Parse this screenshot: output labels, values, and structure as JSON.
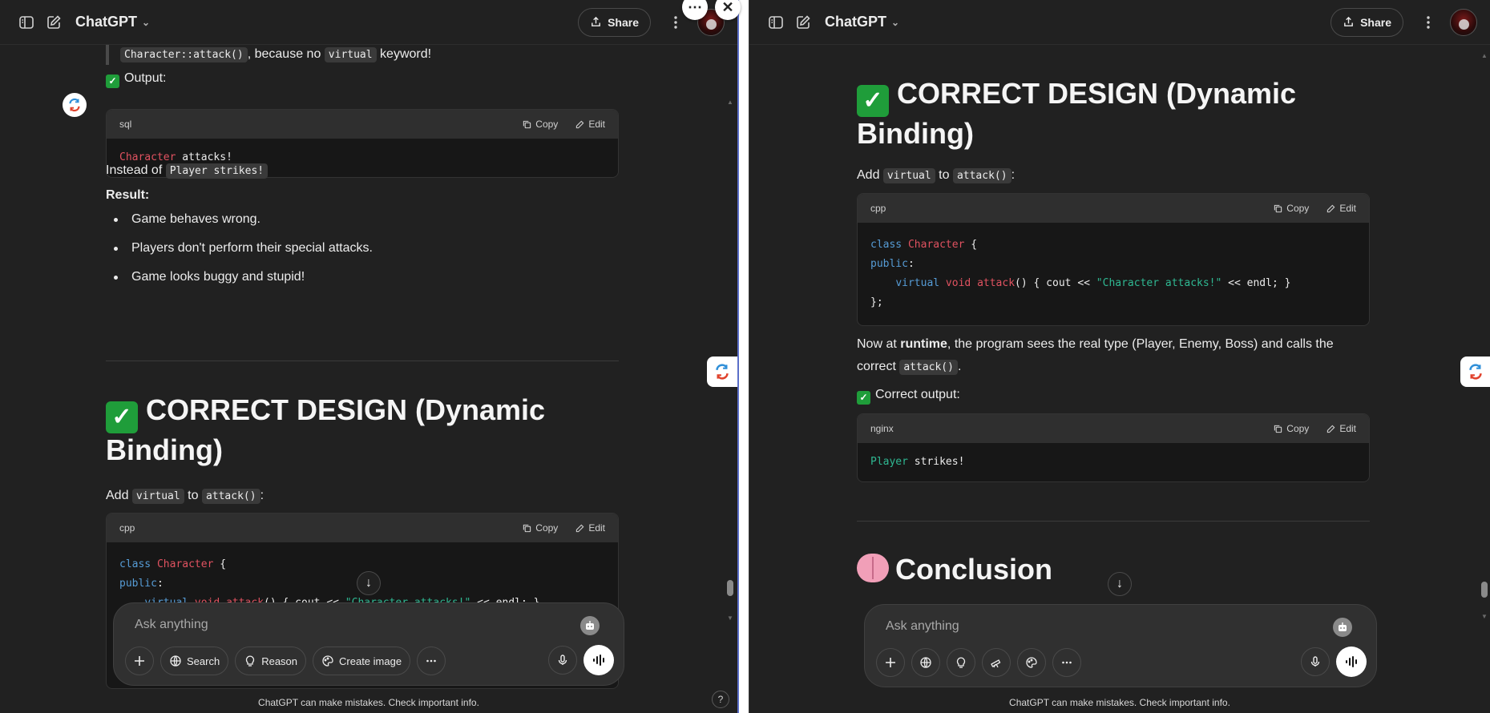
{
  "left": {
    "header": {
      "title": "ChatGPT",
      "share_label": "Share"
    },
    "partial_line": {
      "code": "Character::attack()",
      "middle": ", because no ",
      "code2": "virtual",
      "end": " keyword!"
    },
    "output_label": "Output:",
    "code1": {
      "lang": "sql",
      "copy": "Copy",
      "edit": "Edit",
      "tok_type": "Character",
      "tok_rest": " attacks!"
    },
    "instead": {
      "prefix": "Instead of ",
      "code": "Player strikes!"
    },
    "result_label": "Result:",
    "bullets": [
      "Game behaves wrong.",
      "Players don't perform their special attacks.",
      "Game looks buggy and stupid!"
    ],
    "heading": "CORRECT DESIGN (Dynamic Binding)",
    "add": {
      "prefix": "Add ",
      "code1": "virtual",
      "mid": " to ",
      "code2": "attack()",
      "end": ":"
    },
    "code2": {
      "lang": "cpp",
      "copy": "Copy",
      "edit": "Edit",
      "l1_kw": "class",
      "l1_ty": " Character",
      "l1_rest": " {",
      "l2_kw": "public",
      "l2_rest": ":",
      "l3_indent": "    ",
      "l3_kw": "virtual",
      "l3_ty": " void",
      "l3_fn": " attack",
      "l3_rest1": "() { cout << ",
      "l3_str": "\"Character attacks!\"",
      "l3_rest2": " << endl; }"
    },
    "composer": {
      "placeholder": "Ask anything",
      "search_label": "Search",
      "reason_label": "Reason",
      "create_image_label": "Create image"
    },
    "disclaimer": "ChatGPT can make mistakes. Check important info.",
    "help": "?"
  },
  "right": {
    "header": {
      "title": "ChatGPT",
      "share_label": "Share"
    },
    "heading": "CORRECT DESIGN (Dynamic Binding)",
    "add": {
      "prefix": "Add ",
      "code1": "virtual",
      "mid": " to ",
      "code2": "attack()",
      "end": ":"
    },
    "code1": {
      "lang": "cpp",
      "copy": "Copy",
      "edit": "Edit",
      "l1_kw": "class",
      "l1_ty": " Character",
      "l1_rest": " {",
      "l2_kw": "public",
      "l2_rest": ":",
      "l3_indent": "    ",
      "l3_kw": "virtual",
      "l3_ty": " void",
      "l3_fn": " attack",
      "l3_rest1": "() { cout << ",
      "l3_str": "\"Character attacks!\"",
      "l3_rest2": " << endl; }",
      "l4": "};"
    },
    "runtime": {
      "prefix": "Now at ",
      "bold": "runtime",
      "rest": ", the program sees the real type (Player, Enemy, Boss) and calls the correct ",
      "code": "attack()",
      "end": "."
    },
    "correct_output_label": "Correct output:",
    "code2": {
      "lang": "nginx",
      "copy": "Copy",
      "edit": "Edit",
      "tok_type": "Player",
      "tok_rest": " strikes!"
    },
    "conclusion": "Conclusion",
    "composer": {
      "placeholder": "Ask anything"
    },
    "disclaimer": "ChatGPT can make mistakes. Check important info."
  },
  "colors": {
    "accent_check": "#1f9d3a",
    "code_type": "#e05260",
    "code_keyword": "#569cd6",
    "code_string": "#2fb892"
  }
}
